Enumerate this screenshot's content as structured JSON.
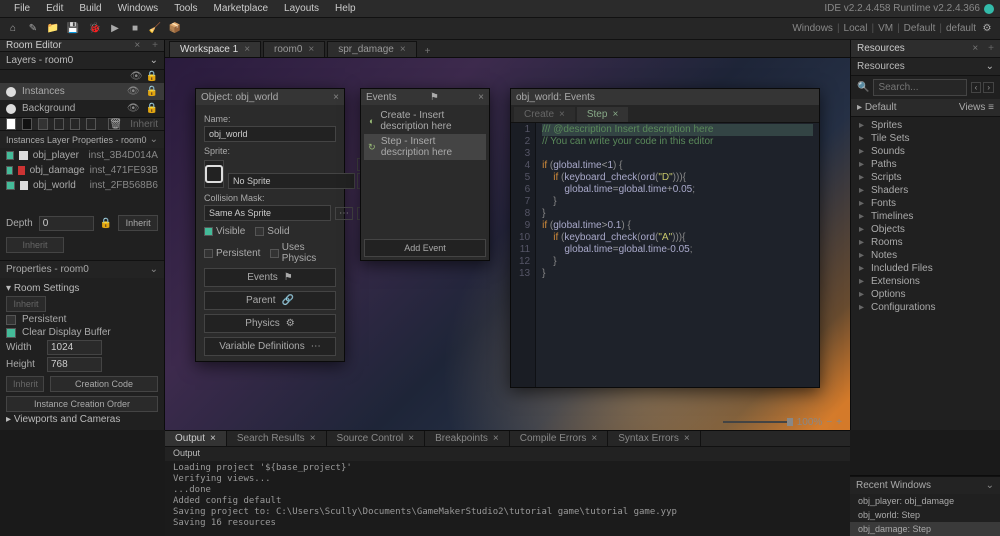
{
  "ide_version": "IDE v2.2.4.458  Runtime v2.2.4.366",
  "menu": [
    "File",
    "Edit",
    "Build",
    "Windows",
    "Tools",
    "Marketplace",
    "Layouts",
    "Help"
  ],
  "status_right": [
    "Windows",
    "Local",
    "VM",
    "Default",
    "default"
  ],
  "room_editor": {
    "tab": "Room Editor",
    "layers_title": "Layers - room0",
    "layers": [
      {
        "name": "Instances",
        "selected": true
      },
      {
        "name": "Background",
        "selected": false
      }
    ],
    "inherit_btn": "Inherit",
    "ilp_title": "Instances Layer Properties - room0",
    "instances": [
      {
        "obj": "obj_player",
        "inst": "inst_3B4D014A",
        "sw": "w"
      },
      {
        "obj": "obj_damage",
        "inst": "inst_471FE93B",
        "sw": "r"
      },
      {
        "obj": "obj_world",
        "inst": "inst_2FB568B6",
        "sw": "w"
      }
    ],
    "depth_label": "Depth",
    "depth_value": "0",
    "props_title": "Properties - room0",
    "room_settings": "Room Settings",
    "persistent": "Persistent",
    "clear_display": "Clear Display Buffer",
    "width_label": "Width",
    "width_value": "1024",
    "height_label": "Height",
    "height_value": "768",
    "creation_code": "Creation Code",
    "instance_order": "Instance Creation Order",
    "viewports": "Viewports and Cameras"
  },
  "workspace_tabs": [
    {
      "label": "Workspace 1",
      "active": true
    },
    {
      "label": "room0",
      "active": false
    },
    {
      "label": "spr_damage",
      "active": false
    }
  ],
  "object_panel": {
    "title": "Object: obj_world",
    "name_label": "Name:",
    "name_value": "obj_world",
    "sprite_label": "Sprite:",
    "sprite_value": "No Sprite",
    "collision_label": "Collision Mask:",
    "collision_value": "Same As Sprite",
    "visible": "Visible",
    "solid": "Solid",
    "persistent": "Persistent",
    "physics": "Uses Physics",
    "events_btn": "Events",
    "parent_btn": "Parent",
    "physics_btn": "Physics",
    "vars_btn": "Variable Definitions"
  },
  "events_panel": {
    "title": "Events",
    "items": [
      {
        "label": "Create - Insert description here",
        "selected": false,
        "icon": "◐"
      },
      {
        "label": "Step - Insert description here",
        "selected": true,
        "icon": "↻"
      }
    ],
    "add_btn": "Add Event"
  },
  "code_panel": {
    "title": "obj_world: Events",
    "tabs": [
      {
        "label": "Create",
        "active": false
      },
      {
        "label": "Step",
        "active": true
      }
    ],
    "lines": [
      {
        "n": 1,
        "html": "<span class='hl'><span class='c'>/// @description Insert description here</span></span>"
      },
      {
        "n": 2,
        "html": "<span class='c'>// You can write your code in this editor</span>"
      },
      {
        "n": 3,
        "html": ""
      },
      {
        "n": 4,
        "html": "<span class='k'>if</span> <span class='p'>(</span><span class='n'>global.time</span>&lt;<span class='n'>1</span><span class='p'>) {</span>"
      },
      {
        "n": 5,
        "html": "    <span class='k'>if</span> <span class='p'>(</span><span class='n'>keyboard_check</span><span class='p'>(</span><span class='n'>ord</span><span class='p'>(</span><span class='s'>\"D\"</span><span class='p'>))){</span>"
      },
      {
        "n": 6,
        "html": "        <span class='n'>global.time</span>=<span class='n'>global.time</span>+<span class='n'>0.05</span><span class='p'>;</span>"
      },
      {
        "n": 7,
        "html": "    <span class='p'>}</span>"
      },
      {
        "n": 8,
        "html": "<span class='p'>}</span>"
      },
      {
        "n": 9,
        "html": "<span class='k'>if</span> <span class='p'>(</span><span class='n'>global.time</span>&gt;<span class='n'>0.1</span><span class='p'>) {</span>"
      },
      {
        "n": 10,
        "html": "    <span class='k'>if</span> <span class='p'>(</span><span class='n'>keyboard_check</span><span class='p'>(</span><span class='n'>ord</span><span class='p'>(</span><span class='s'>\"A\"</span><span class='p'>))){</span>"
      },
      {
        "n": 11,
        "html": "        <span class='n'>global.time</span>=<span class='n'>global.time</span>-<span class='n'>0.05</span><span class='p'>;</span>"
      },
      {
        "n": 12,
        "html": "    <span class='p'>}</span>"
      },
      {
        "n": 13,
        "html": "<span class='p'>}</span>"
      }
    ]
  },
  "resources": {
    "tab": "Resources",
    "header": "Resources",
    "search_placeholder": "Search...",
    "default_label": "Default",
    "views_label": "Views",
    "tree": [
      "Sprites",
      "Tile Sets",
      "Sounds",
      "Paths",
      "Scripts",
      "Shaders",
      "Fonts",
      "Timelines",
      "Objects",
      "Rooms",
      "Notes",
      "Included Files",
      "Extensions",
      "Options",
      "Configurations"
    ]
  },
  "output": {
    "tabs": [
      "Output",
      "Search Results",
      "Source Control",
      "Breakpoints",
      "Compile Errors",
      "Syntax Errors"
    ],
    "sub": "Output",
    "lines": "Loading project '${base_project}'\nVerifying views...\n...done\nAdded config default\nSaving project to: C:\\Users\\Scully\\Documents\\GameMakerStudio2\\tutorial game\\tutorial game.yyp\nSaving 16 resources"
  },
  "recent": {
    "title": "Recent Windows",
    "items": [
      {
        "label": "obj_player: obj_damage",
        "sel": false
      },
      {
        "label": "obj_world: Step",
        "sel": false
      },
      {
        "label": "obj_damage: Step",
        "sel": true
      }
    ]
  },
  "zoom": "100%"
}
